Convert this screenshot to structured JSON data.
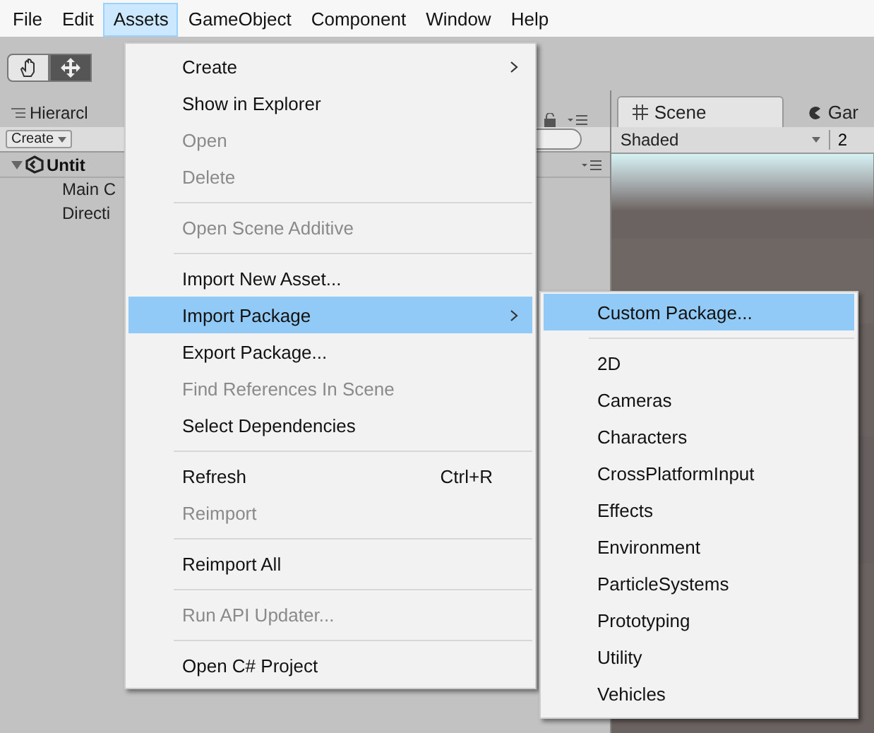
{
  "menu_bar": [
    {
      "label": "File",
      "selected": false
    },
    {
      "label": "Edit",
      "selected": false
    },
    {
      "label": "Assets",
      "selected": true
    },
    {
      "label": "GameObject",
      "selected": false
    },
    {
      "label": "Component",
      "selected": false
    },
    {
      "label": "Window",
      "selected": false
    },
    {
      "label": "Help",
      "selected": false
    }
  ],
  "toolbar": {
    "tools": [
      {
        "kind": "hand",
        "selected": false
      },
      {
        "kind": "move",
        "selected": true
      }
    ]
  },
  "hierarchy": {
    "tab": "Hierarcl",
    "create_button": "Create",
    "tree": [
      {
        "label": "Untit",
        "expanded": true,
        "children": [
          {
            "label": "Main C"
          },
          {
            "label": "Directi"
          }
        ]
      }
    ]
  },
  "scene": {
    "tabs": [
      {
        "label": "Scene",
        "kind": "scene",
        "selected": true
      },
      {
        "label": "Gar",
        "kind": "game",
        "selected": false
      }
    ],
    "shading": "Shaded",
    "toolbar_next": "2"
  },
  "assets_menu": [
    {
      "kind": "item",
      "label": "Create",
      "disabled": false,
      "selected": false,
      "submenu": true
    },
    {
      "kind": "item",
      "label": "Show in Explorer",
      "disabled": false,
      "selected": false
    },
    {
      "kind": "item",
      "label": "Open",
      "disabled": true,
      "selected": false
    },
    {
      "kind": "item",
      "label": "Delete",
      "disabled": true,
      "selected": false
    },
    {
      "kind": "separator"
    },
    {
      "kind": "item",
      "label": "Open Scene Additive",
      "disabled": true,
      "selected": false
    },
    {
      "kind": "separator"
    },
    {
      "kind": "item",
      "label": "Import New Asset...",
      "disabled": false,
      "selected": false
    },
    {
      "kind": "item",
      "label": "Import Package",
      "disabled": false,
      "selected": true,
      "submenu": true
    },
    {
      "kind": "item",
      "label": "Export Package...",
      "disabled": false,
      "selected": false
    },
    {
      "kind": "item",
      "label": "Find References In Scene",
      "disabled": true,
      "selected": false
    },
    {
      "kind": "item",
      "label": "Select Dependencies",
      "disabled": false,
      "selected": false
    },
    {
      "kind": "separator"
    },
    {
      "kind": "item",
      "label": "Refresh",
      "disabled": false,
      "selected": false,
      "shortcut": "Ctrl+R"
    },
    {
      "kind": "item",
      "label": "Reimport",
      "disabled": true,
      "selected": false
    },
    {
      "kind": "separator"
    },
    {
      "kind": "item",
      "label": "Reimport All",
      "disabled": false,
      "selected": false
    },
    {
      "kind": "separator"
    },
    {
      "kind": "item",
      "label": "Run API Updater...",
      "disabled": true,
      "selected": false
    },
    {
      "kind": "separator"
    },
    {
      "kind": "item",
      "label": "Open C# Project",
      "disabled": false,
      "selected": false
    }
  ],
  "import_package_submenu": [
    {
      "kind": "item",
      "label": "Custom Package...",
      "disabled": false,
      "selected": true
    },
    {
      "kind": "separator"
    },
    {
      "kind": "item",
      "label": "2D",
      "disabled": false,
      "selected": false
    },
    {
      "kind": "item",
      "label": "Cameras",
      "disabled": false,
      "selected": false
    },
    {
      "kind": "item",
      "label": "Characters",
      "disabled": false,
      "selected": false
    },
    {
      "kind": "item",
      "label": "CrossPlatformInput",
      "disabled": false,
      "selected": false
    },
    {
      "kind": "item",
      "label": "Effects",
      "disabled": false,
      "selected": false
    },
    {
      "kind": "item",
      "label": "Environment",
      "disabled": false,
      "selected": false
    },
    {
      "kind": "item",
      "label": "ParticleSystems",
      "disabled": false,
      "selected": false
    },
    {
      "kind": "item",
      "label": "Prototyping",
      "disabled": false,
      "selected": false
    },
    {
      "kind": "item",
      "label": "Utility",
      "disabled": false,
      "selected": false
    },
    {
      "kind": "item",
      "label": "Vehicles",
      "disabled": false,
      "selected": false
    }
  ]
}
